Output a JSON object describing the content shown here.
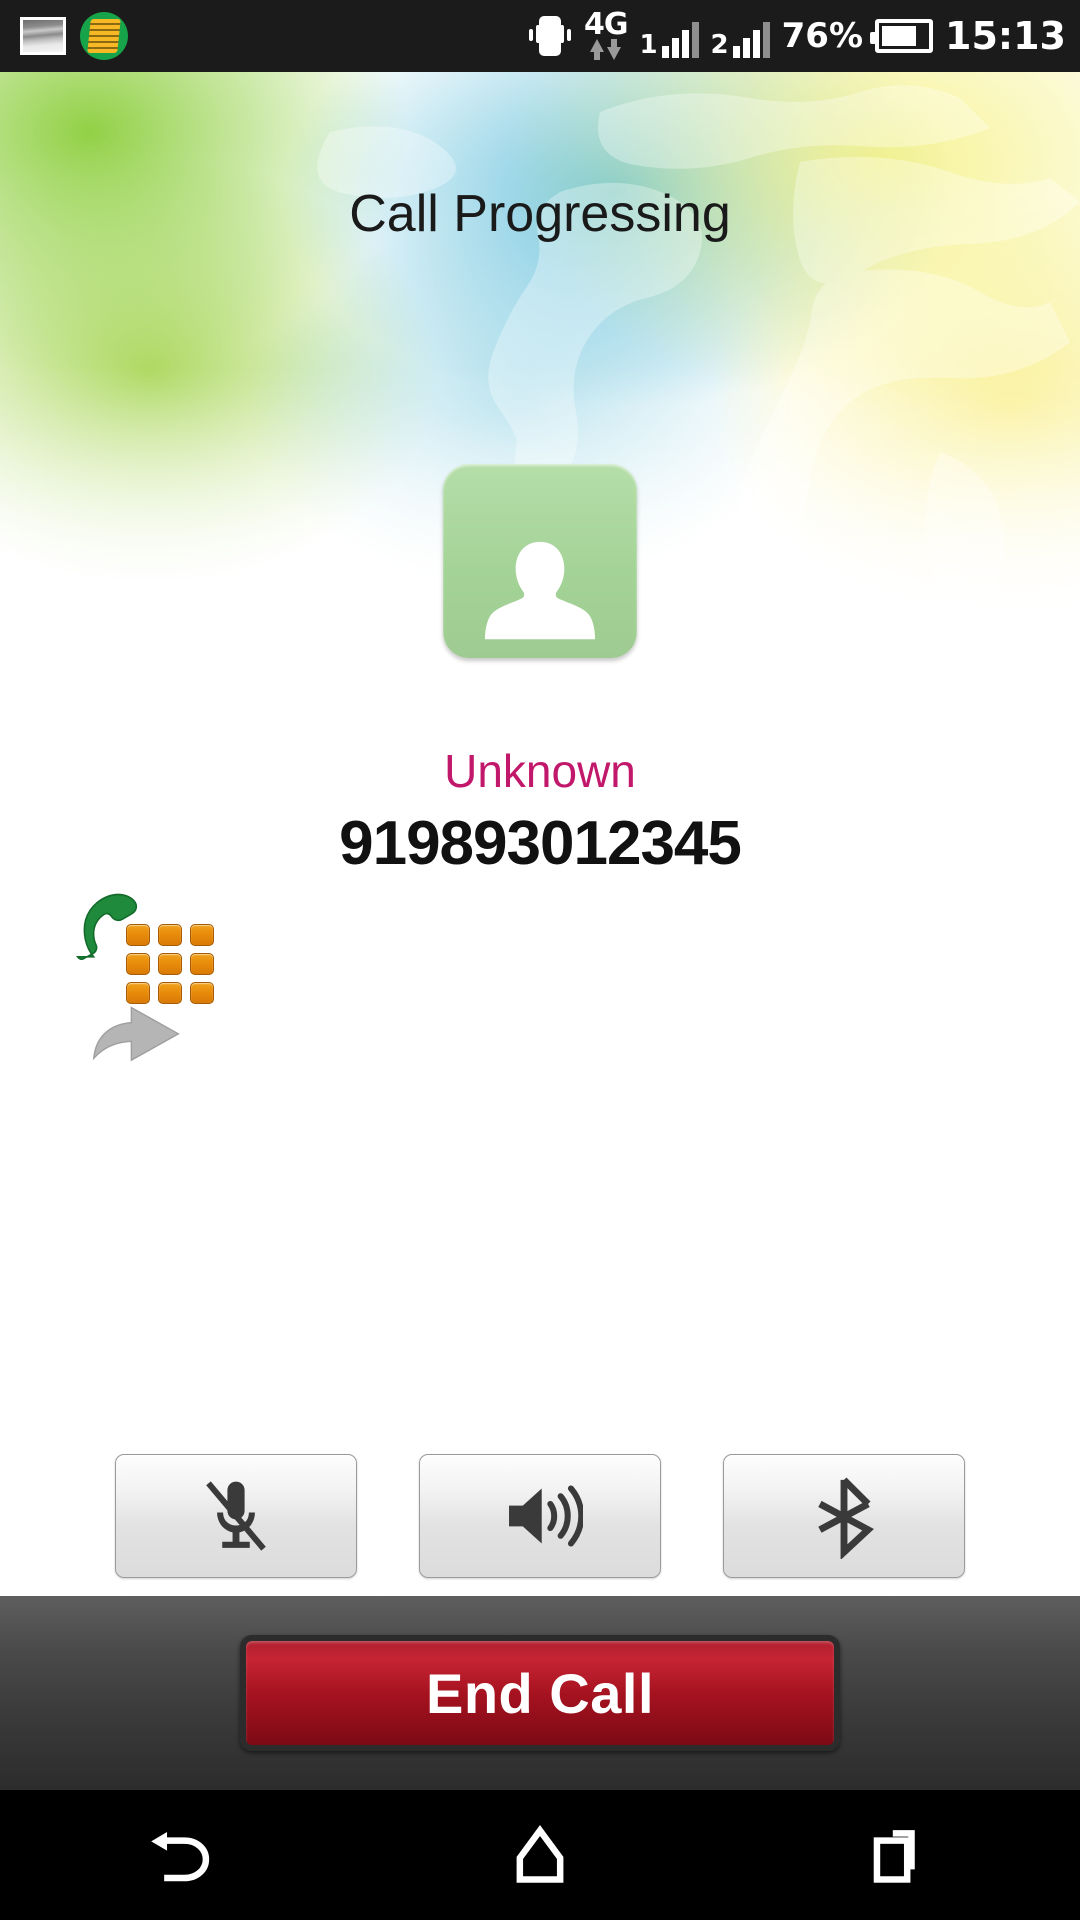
{
  "status_bar": {
    "left_icons": [
      {
        "name": "gallery-image-icon",
        "label": "Screenshot captured"
      },
      {
        "name": "app-notification-icon",
        "label": "App notification"
      }
    ],
    "vibrate_icon": "vibrate-icon",
    "network_type": "4G",
    "data_arrows": "data-transfer-arrows",
    "sim1_label": "1",
    "sim2_label": "2",
    "battery_percent": "76%",
    "battery_icon": "battery-icon",
    "clock": "15:13"
  },
  "call": {
    "state": "Call Progressing",
    "avatar_icon": "contact-avatar-placeholder",
    "contact_name": "Unknown",
    "contact_number": "919893012345",
    "name_color": "#c2186b",
    "avatar_color": "#a4d397"
  },
  "side_tools": [
    {
      "name": "dialpad-icon",
      "label": "Dialpad"
    },
    {
      "name": "forward-arrow-icon",
      "label": "Forward call"
    }
  ],
  "controls": [
    {
      "name": "mute-button",
      "icon": "microphone-muted-icon",
      "label": "Mute"
    },
    {
      "name": "speaker-button",
      "icon": "speaker-icon",
      "label": "Speaker"
    },
    {
      "name": "bluetooth-button",
      "icon": "bluetooth-icon",
      "label": "Bluetooth"
    }
  ],
  "end_call": {
    "label": "End Call",
    "color": "#a5121f"
  },
  "nav_bar": [
    {
      "name": "nav-back-button",
      "icon": "back-arrow-icon",
      "label": "Back"
    },
    {
      "name": "nav-home-button",
      "icon": "home-icon",
      "label": "Home"
    },
    {
      "name": "nav-recents-button",
      "icon": "recent-apps-icon",
      "label": "Recent apps"
    }
  ]
}
